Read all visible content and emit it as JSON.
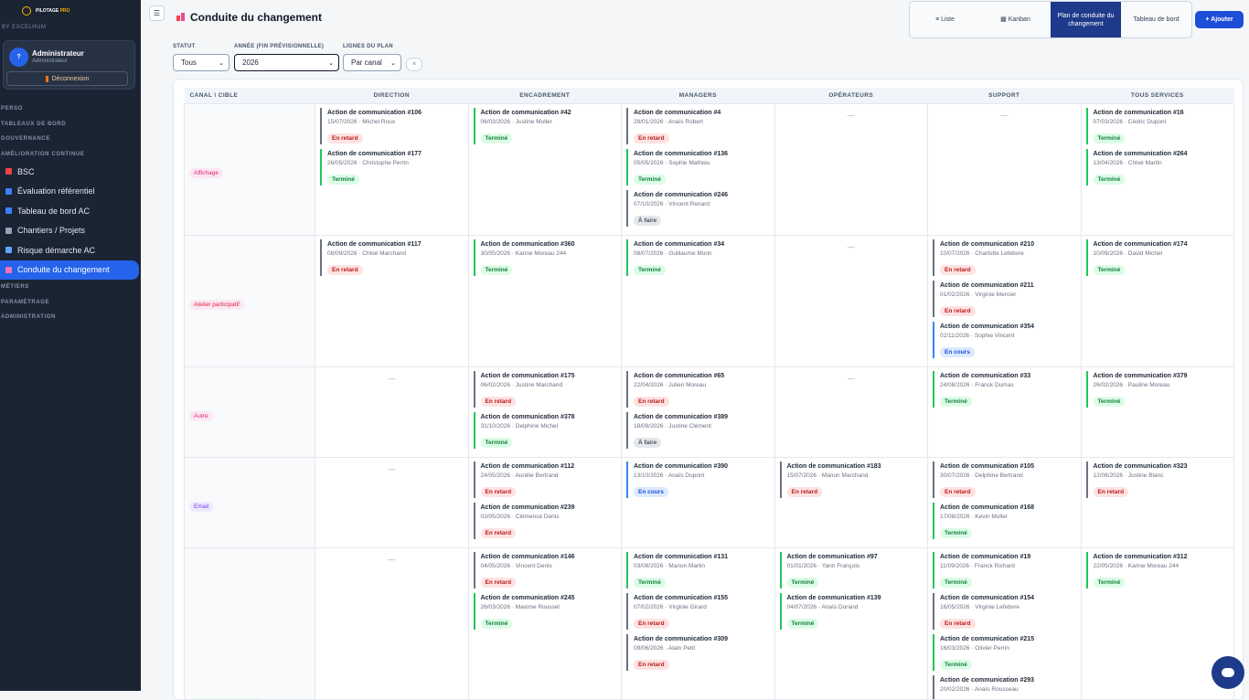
{
  "sidebar": {
    "logo_main": "PILOTAGE",
    "logo_suffix": "PRO",
    "byline": "BY EXCELHUM",
    "user": {
      "avatar": "?",
      "name": "Administrateur",
      "role": "Administrateur",
      "logout": "Déconnexion"
    },
    "sections": {
      "perso": "PERSO",
      "tableaux": "TABLEAUX DE BORD",
      "gouvernance": "GOUVERNANCE",
      "amelioration": "AMÉLIORATION CONTINUE",
      "metiers": "MÉTIERS",
      "parametrage": "PARAMÉTRAGE",
      "administration": "ADMINISTRATION"
    },
    "items": [
      {
        "label": "BSC",
        "icon": "target-icon",
        "color": "#ef4444"
      },
      {
        "label": "Évaluation référentiel",
        "icon": "chart-icon",
        "color": "#3b82f6"
      },
      {
        "label": "Tableau de bord AC",
        "icon": "dashboard-icon",
        "color": "#3b82f6"
      },
      {
        "label": "Chantiers / Projets",
        "icon": "tools-icon",
        "color": "#94a3b8"
      },
      {
        "label": "Risque démarche AC",
        "icon": "shield-icon",
        "color": "#60a5fa"
      },
      {
        "label": "Conduite du changement",
        "icon": "megaphone-icon",
        "color": "#f472b6"
      }
    ]
  },
  "header": {
    "menu_icon": "☰",
    "title": "Conduite du changement",
    "views": [
      {
        "label": "≡ Liste"
      },
      {
        "label": "▦ Kanban"
      },
      {
        "label": "Plan de conduite du changement"
      },
      {
        "label": "Tableau de bord"
      }
    ],
    "add_label": "+ Ajouter"
  },
  "filters": {
    "statut_label": "STATUT",
    "statut_value": "Tous",
    "annee_label": "ANNÉE (FIN PRÉVISIONNELLE)",
    "annee_value": "2026",
    "lignes_label": "LIGNES DU PLAN",
    "lignes_value": "Par canal",
    "clear": "×"
  },
  "board": {
    "corner": "CANAL \\ CIBLE",
    "columns": [
      "DIRECTION",
      "ENCADREMENT",
      "MANAGERS",
      "OPÉRATEURS",
      "SUPPORT",
      "TOUS SERVICES"
    ],
    "rows": [
      {
        "label": "Affichage",
        "chip_bg": "#fce7f3",
        "chip_fg": "#db2777",
        "cells": [
          [
            {
              "title": "Action de communication #106",
              "meta": "15/07/2026 · Michel Roux",
              "status": "En retard"
            },
            {
              "title": "Action de communication #177",
              "meta": "26/05/2026 · Christophe Perrin",
              "status": "Terminé"
            }
          ],
          [
            {
              "title": "Action de communication #42",
              "meta": "06/03/2026 · Justine Muller",
              "status": "Terminé"
            }
          ],
          [
            {
              "title": "Action de communication #4",
              "meta": "28/01/2026 · Anaïs Robert",
              "status": "En retard"
            },
            {
              "title": "Action de communication #136",
              "meta": "05/05/2026 · Sophie Mathieu",
              "status": "Terminé"
            },
            {
              "title": "Action de communication #246",
              "meta": "07/10/2026 · Vincent Renard",
              "status": "À faire"
            }
          ],
          [],
          [],
          [
            {
              "title": "Action de communication #16",
              "meta": "07/03/2026 · Cédric Dupont",
              "status": "Terminé"
            },
            {
              "title": "Action de communication #264",
              "meta": "13/04/2026 · Chloé Martin",
              "status": "Terminé"
            }
          ]
        ]
      },
      {
        "label": "Atelier participatif",
        "chip_bg": "#fce7f3",
        "chip_fg": "#e11d48",
        "cells": [
          [
            {
              "title": "Action de communication #117",
              "meta": "08/09/2026 · Chloé Marchand",
              "status": "En retard"
            }
          ],
          [
            {
              "title": "Action de communication #360",
              "meta": "30/05/2026 · Karine Moreau 244",
              "status": "Terminé"
            }
          ],
          [
            {
              "title": "Action de communication #34",
              "meta": "08/07/2026 · Guillaume Morin",
              "status": "Terminé"
            }
          ],
          [],
          [
            {
              "title": "Action de communication #210",
              "meta": "10/07/2026 · Charlotte Lefebvre",
              "status": "En retard"
            },
            {
              "title": "Action de communication #211",
              "meta": "01/02/2026 · Virginie Mercier",
              "status": "En retard"
            },
            {
              "title": "Action de communication #354",
              "meta": "02/11/2026 · Sophie Vincent",
              "status": "En cours"
            }
          ],
          [
            {
              "title": "Action de communication #174",
              "meta": "10/09/2026 · David Michel",
              "status": "Terminé"
            }
          ]
        ]
      },
      {
        "label": "Autre",
        "chip_bg": "#fce7f3",
        "chip_fg": "#db2777",
        "cells": [
          [],
          [
            {
              "title": "Action de communication #175",
              "meta": "06/02/2026 · Justine Marchand",
              "status": "En retard"
            },
            {
              "title": "Action de communication #378",
              "meta": "31/10/2026 · Delphine Michel",
              "status": "Terminé"
            }
          ],
          [
            {
              "title": "Action de communication #65",
              "meta": "22/04/2026 · Julien Moreau",
              "status": "En retard"
            },
            {
              "title": "Action de communication #389",
              "meta": "18/09/2026 · Justine Clément",
              "status": "À faire"
            }
          ],
          [],
          [
            {
              "title": "Action de communication #33",
              "meta": "24/08/2026 · Franck Dumas",
              "status": "Terminé"
            }
          ],
          [
            {
              "title": "Action de communication #379",
              "meta": "26/02/2026 · Pauline Moreau",
              "status": "Terminé"
            }
          ]
        ]
      },
      {
        "label": "Email",
        "chip_bg": "#ede9fe",
        "chip_fg": "#7c3aed",
        "cells": [
          [],
          [
            {
              "title": "Action de communication #112",
              "meta": "24/05/2026 · Aurélie Bertrand",
              "status": "En retard"
            },
            {
              "title": "Action de communication #239",
              "meta": "03/05/2026 · Clémence Denis",
              "status": "En retard"
            }
          ],
          [
            {
              "title": "Action de communication #390",
              "meta": "13/10/2026 · Anaïs Dupont",
              "status": "En cours"
            }
          ],
          [
            {
              "title": "Action de communication #183",
              "meta": "15/07/2026 · Marion Marchand",
              "status": "En retard"
            }
          ],
          [
            {
              "title": "Action de communication #105",
              "meta": "30/07/2026 · Delphine Bertrand",
              "status": "En retard"
            },
            {
              "title": "Action de communication #168",
              "meta": "17/08/2026 · Kevin Muller",
              "status": "Terminé"
            }
          ],
          [
            {
              "title": "Action de communication #323",
              "meta": "12/08/2026 · Justine Blanc",
              "status": "En retard"
            }
          ]
        ]
      },
      {
        "label": "",
        "chip_bg": "#dcfce7",
        "chip_fg": "#16a34a",
        "cells": [
          [],
          [
            {
              "title": "Action de communication #146",
              "meta": "04/05/2026 · Vincent Denis",
              "status": "En retard"
            },
            {
              "title": "Action de communication #245",
              "meta": "26/03/2026 · Maxime Roussel",
              "status": "Terminé"
            }
          ],
          [
            {
              "title": "Action de communication #131",
              "meta": "03/08/2026 · Manon Martin",
              "status": "Terminé"
            },
            {
              "title": "Action de communication #155",
              "meta": "07/02/2026 · Virginie Girard",
              "status": "En retard"
            },
            {
              "title": "Action de communication #309",
              "meta": "09/06/2026 · Alain Petit",
              "status": "En retard"
            }
          ],
          [
            {
              "title": "Action de communication #97",
              "meta": "01/01/2026 · Yann François",
              "status": "Terminé"
            },
            {
              "title": "Action de communication #139",
              "meta": "04/07/2026 · Anaïs Durand",
              "status": "Terminé"
            }
          ],
          [
            {
              "title": "Action de communication #19",
              "meta": "11/09/2026 · Franck Richard",
              "status": "Terminé"
            },
            {
              "title": "Action de communication #154",
              "meta": "16/05/2026 · Virginie Lefebvre",
              "status": "En retard"
            },
            {
              "title": "Action de communication #215",
              "meta": "16/03/2026 · Olivier Perrin",
              "status": "Terminé"
            },
            {
              "title": "Action de communication #293",
              "meta": "20/02/2026 · Anaïs Rousseau",
              "status": ""
            }
          ],
          [
            {
              "title": "Action de communication #312",
              "meta": "22/05/2026 · Karine Moreau 244",
              "status": "Terminé"
            }
          ]
        ]
      }
    ],
    "empty_marker": "—"
  },
  "chat_icon": "chat-bubble-icon"
}
